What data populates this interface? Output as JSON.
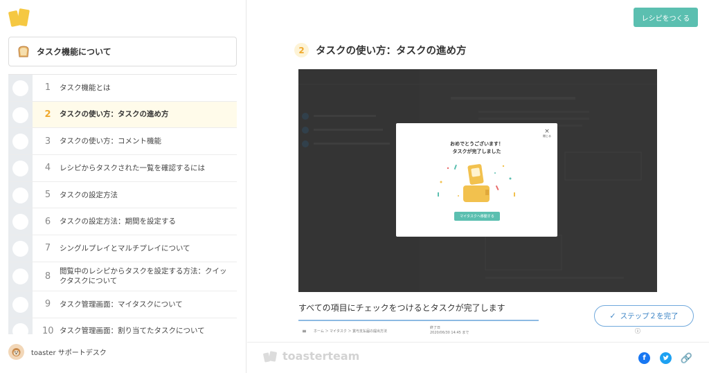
{
  "sidebar": {
    "title": "タスク機能について",
    "steps": [
      {
        "num": "1",
        "label": "タスク機能とは",
        "active": false
      },
      {
        "num": "2",
        "label": "タスクの使い方：タスクの進め方",
        "active": true
      },
      {
        "num": "3",
        "label": "タスクの使い方：コメント機能",
        "active": false
      },
      {
        "num": "4",
        "label": "レシピからタスクされた一覧を確認するには",
        "active": false
      },
      {
        "num": "5",
        "label": "タスクの設定方法",
        "active": false
      },
      {
        "num": "6",
        "label": "タスクの設定方法：期間を設定する",
        "active": false
      },
      {
        "num": "7",
        "label": "シングルプレイとマルチプレイについて",
        "active": false
      },
      {
        "num": "8",
        "label": "閲覧中のレシピからタスクを設定する方法：クイックタスクについて",
        "active": false
      },
      {
        "num": "9",
        "label": "タスク管理画面：マイタスクについて",
        "active": false
      },
      {
        "num": "10",
        "label": "タスク管理画面：割り当てたタスクについて",
        "active": false
      }
    ],
    "support_name": "toaster サポートデスク"
  },
  "header": {
    "cta_label": "レシピをつくる"
  },
  "main": {
    "step_number": "2",
    "step_title": "タスクの使い方：タスクの進め方",
    "modal": {
      "close_label": "閉じる",
      "message_line1": "おめでとうございます！",
      "message_line2": "タスクが完了しました",
      "button_label": "マイタスクへ移動する"
    },
    "caption": "すべての項目にチェックをつけるとタスクが完了します",
    "preview": {
      "breadcrumb": "ホーム ＞ マイタスク ＞ 賞与支払届の提出方法",
      "due_label": "終了日",
      "due_value": "2020/06/30 14:45 まで"
    },
    "complete_label": "ステップ２を完了"
  },
  "footer": {
    "brand": "toasterteam"
  },
  "colors": {
    "accent": "#5bbfb0",
    "step_highlight": "#f0a92c",
    "complete_border": "#6fa8dc",
    "facebook": "#1877f2",
    "twitter": "#1da1f2"
  }
}
